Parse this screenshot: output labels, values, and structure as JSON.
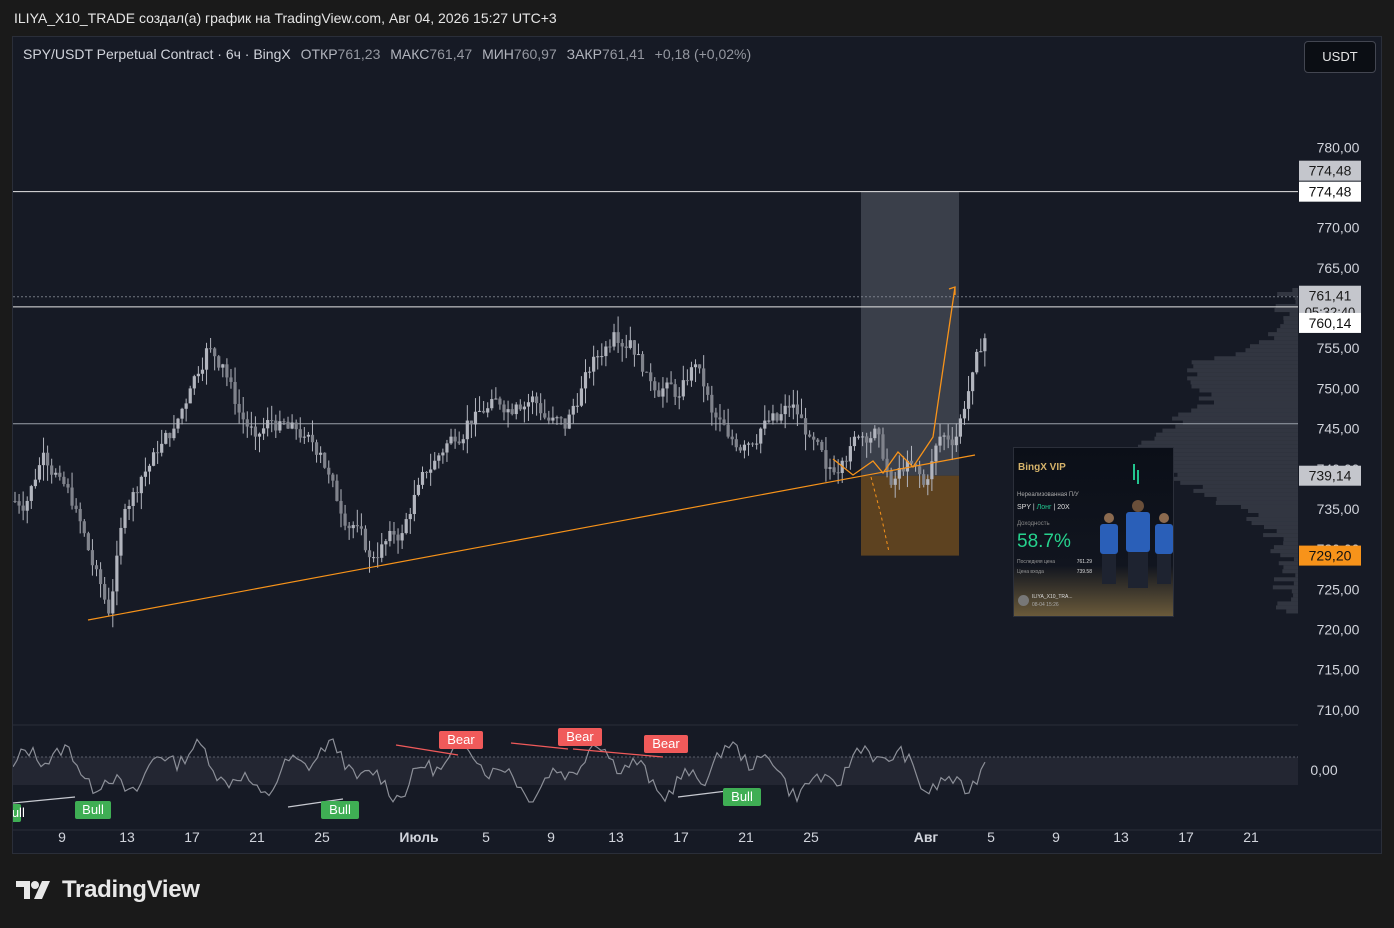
{
  "header": {
    "caption": "ILIYA_X10_TRADE создал(a) график на TradingView.com, Авг 04, 2026 15:27 UTC+3"
  },
  "legend": {
    "symbol": "SPY/USDT Perpetual Contract · 6ч · BingX",
    "open_label": "ОТКР",
    "open": "761,23",
    "high_label": "МАКС",
    "high": "761,47",
    "low_label": "МИН",
    "low": "760,97",
    "close_label": "ЗАКР",
    "close": "761,41",
    "change": "+0,18 (+0,02%)"
  },
  "currency_button": "USDT",
  "price_axis": {
    "ticks": [
      {
        "label": "780,00",
        "price": 780
      },
      {
        "label": "775,00",
        "price": 775
      },
      {
        "label": "770,00",
        "price": 770
      },
      {
        "label": "765,00",
        "price": 765
      },
      {
        "label": "760,00",
        "price": 760
      },
      {
        "label": "755,00",
        "price": 755
      },
      {
        "label": "750,00",
        "price": 750
      },
      {
        "label": "745,00",
        "price": 745
      },
      {
        "label": "740,00",
        "price": 740
      },
      {
        "label": "735,00",
        "price": 735
      },
      {
        "label": "730,00",
        "price": 730
      },
      {
        "label": "725,00",
        "price": 725
      },
      {
        "label": "720,00",
        "price": 720
      },
      {
        "label": "715,00",
        "price": 715
      },
      {
        "label": "710,00",
        "price": 710
      }
    ],
    "range": [
      707.5,
      788.5
    ],
    "badges": [
      {
        "price": 774.48,
        "text": "774,48",
        "style": "gray",
        "pos": "above"
      },
      {
        "price": 774.48,
        "text": "774,48",
        "style": "white",
        "pos": "at"
      },
      {
        "price": 761.41,
        "text": "761,41",
        "sub": "05:32:40",
        "style": "gray",
        "pos": "below"
      },
      {
        "price": 760.14,
        "text": "760,14",
        "style": "white",
        "pos": "after"
      },
      {
        "price": 739.14,
        "text": "739,14",
        "style": "gray",
        "pos": "at"
      },
      {
        "price": 729.2,
        "text": "729,20",
        "style": "orange",
        "pos": "at"
      }
    ]
  },
  "horizontal_lines": [
    {
      "price": 774.48,
      "color": "#e6e6e6"
    },
    {
      "price": 760.14,
      "color": "#e6e6e6"
    },
    {
      "price": 745.6,
      "color": "#9aa0aa"
    },
    {
      "price": 761.41,
      "color": "#8a8f9a",
      "dotted": true
    }
  ],
  "oscillator": {
    "zero_label": "0,00",
    "labels": [
      {
        "text": "Bull",
        "kind": "bull"
      },
      {
        "text": "Bull",
        "kind": "bull"
      },
      {
        "text": "Bull",
        "kind": "bull"
      },
      {
        "text": "Bull",
        "kind": "bull"
      },
      {
        "text": "Bear",
        "kind": "bear"
      },
      {
        "text": "Bear",
        "kind": "bear"
      },
      {
        "text": "Bear",
        "kind": "bear"
      }
    ]
  },
  "time_axis": [
    "9",
    "13",
    "17",
    "21",
    "25",
    "Июль",
    "5",
    "9",
    "13",
    "17",
    "21",
    "25",
    "Авг",
    "5",
    "9",
    "13",
    "17",
    "21"
  ],
  "position_tool": {
    "entry": 739.14,
    "stop": 729.2,
    "target": 774.48
  },
  "promo_card": {
    "brand": "BingX VIP",
    "pnl_label": "Нереализованная П/У",
    "pair": "SPY",
    "side": "Лонг",
    "leverage": "20X",
    "roi_label": "Доходность",
    "roi": "58.7%",
    "last_price_label": "Последняя цена",
    "last_price": "761.29",
    "entry_label": "Цена входа",
    "entry_price": "739.58",
    "user": "ILIYA_X10_TRA...",
    "date": "08-04 15:26"
  },
  "brand": {
    "name": "TradingView"
  },
  "colors": {
    "background": "#161a25",
    "candle": "#b2b5be",
    "orange": "#f7931a",
    "bull": "#3fae54",
    "bear": "#f05a5a",
    "zone_profit": "#5a5e69",
    "zone_loss": "#6a4a20"
  },
  "chart_data": {
    "type": "candlestick",
    "title": "",
    "xlabel": "",
    "ylabel": "",
    "ylim": [
      707.5,
      788.5
    ],
    "interval": "6h",
    "x": [
      "Jun 5",
      "Jun 6",
      "Jun 7",
      "Jun 8",
      "Jun 9",
      "Jun 10",
      "Jun 11",
      "Jun 12",
      "Jun 13",
      "Jun 14",
      "Jun 15",
      "Jun 16",
      "Jun 17",
      "Jun 18",
      "Jun 19",
      "Jun 20",
      "Jun 21",
      "Jun 22",
      "Jun 23",
      "Jun 24",
      "Jun 25",
      "Jun 26",
      "Jun 27",
      "Jun 28",
      "Jun 29",
      "Jun 30",
      "Jul 1",
      "Jul 2",
      "Jul 3",
      "Jul 4",
      "Jul 5",
      "Jul 6",
      "Jul 7",
      "Jul 8",
      "Jul 9",
      "Jul 10",
      "Jul 11",
      "Jul 12",
      "Jul 13",
      "Jul 14",
      "Jul 15",
      "Jul 16",
      "Jul 17",
      "Jul 18",
      "Jul 19",
      "Jul 20",
      "Jul 21",
      "Jul 22",
      "Jul 23",
      "Jul 24",
      "Jul 25",
      "Jul 26",
      "Jul 27",
      "Jul 28",
      "Jul 29",
      "Jul 30",
      "Jul 31",
      "Aug 1",
      "Aug 2",
      "Aug 3",
      "Aug 4"
    ],
    "close": [
      736,
      742,
      739,
      735,
      728,
      722,
      735,
      739,
      742,
      745,
      750,
      755,
      753,
      747,
      744,
      746,
      745,
      744,
      742,
      736,
      733,
      729,
      731,
      732,
      738,
      741,
      744,
      746,
      747,
      748,
      748,
      749,
      746,
      745,
      750,
      754,
      757,
      756,
      752,
      750,
      749,
      753,
      747,
      744,
      743,
      745,
      746,
      748,
      744,
      740,
      741,
      744,
      745,
      738,
      741,
      738,
      744,
      744,
      752,
      758,
      761
    ]
  }
}
